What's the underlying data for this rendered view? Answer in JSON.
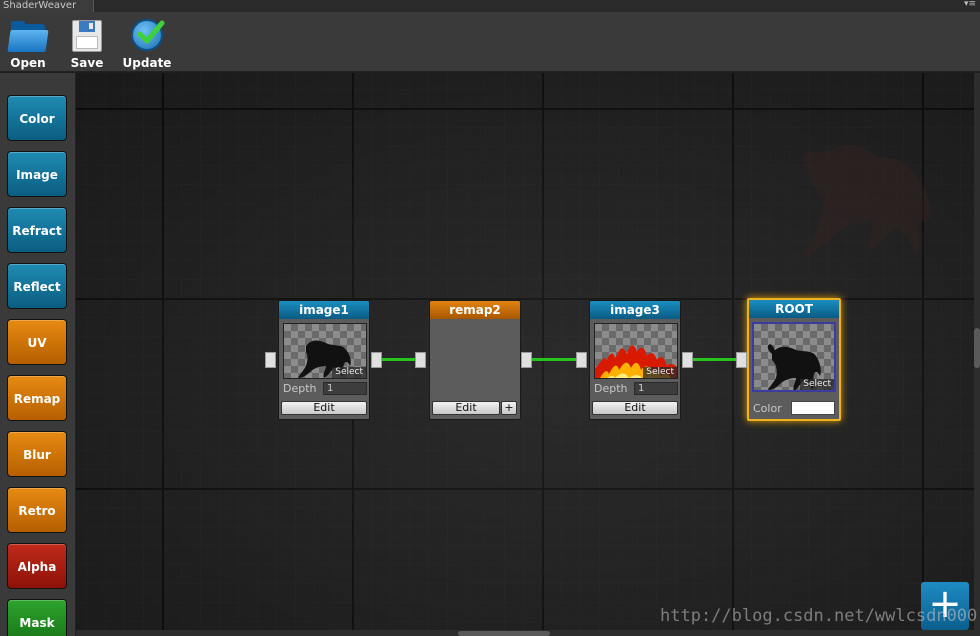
{
  "window": {
    "tab_title": "ShaderWeaver",
    "tab_menu_glyph": "▾≡"
  },
  "toolbar": {
    "open_label": "Open",
    "save_label": "Save",
    "update_label": "Update"
  },
  "sidebar": {
    "items": [
      {
        "label": "Color",
        "color": "blue"
      },
      {
        "label": "Image",
        "color": "blue"
      },
      {
        "label": "Refract",
        "color": "blue"
      },
      {
        "label": "Reflect",
        "color": "blue"
      },
      {
        "label": "UV",
        "color": "orange"
      },
      {
        "label": "Remap",
        "color": "orange"
      },
      {
        "label": "Blur",
        "color": "orange"
      },
      {
        "label": "Retro",
        "color": "orange"
      },
      {
        "label": "Alpha",
        "color": "red"
      },
      {
        "label": "Mask",
        "color": "green"
      }
    ]
  },
  "nodes": {
    "image1": {
      "title": "image1",
      "select_label": "Select",
      "depth_label": "Depth",
      "depth_value": "1",
      "edit_label": "Edit",
      "thumb_icon": "horse-icon"
    },
    "remap2": {
      "title": "remap2",
      "edit_label": "Edit",
      "add_label": "+"
    },
    "image3": {
      "title": "image3",
      "select_label": "Select",
      "depth_label": "Depth",
      "depth_value": "1",
      "edit_label": "Edit",
      "thumb_icon": "fire-icon"
    },
    "root": {
      "title": "ROOT",
      "select_label": "Select",
      "color_label": "Color",
      "color_value": "#ffffff",
      "thumb_icon": "horse-icon"
    }
  },
  "colors": {
    "node_blue": "#0a5b84",
    "node_orange": "#a85700",
    "wire_green": "#27c31f",
    "root_highlight": "#f0b020"
  },
  "canvas": {
    "add_button_label": "+"
  },
  "watermark": {
    "url": "http://blog.csdn.net/wwlcsdn000"
  }
}
